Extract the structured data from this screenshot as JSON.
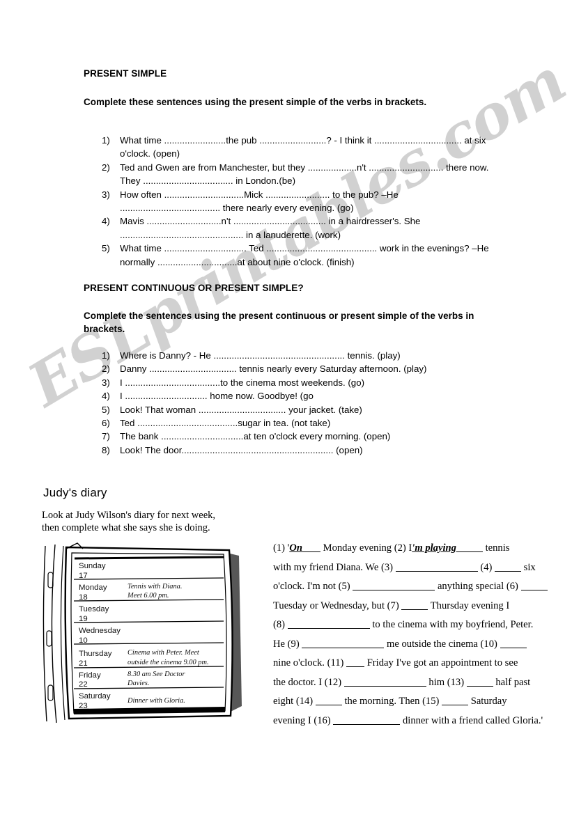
{
  "watermark": {
    "text": "ESLprintables.com"
  },
  "section1": {
    "title": "PRESENT SIMPLE",
    "instruction": "Complete these sentences using the present simple of the verbs in brackets.",
    "items": [
      {
        "num": "1)",
        "text": "What time ........................the pub ..........................?  - I think it .................................. at six o'clock. (open)"
      },
      {
        "num": "2)",
        "text": "Ted and Gwen are from Manchester, but they ...................n't ............................. there now. They ................................... in London.(be)"
      },
      {
        "num": "3)",
        "text": "How often ...............................Mick ......................... to the pub? –He ....................................... there nearly every evening. (go)"
      },
      {
        "num": "4)",
        "text": "Mavis .............................n't .................................... in a hairdresser's. She ................................................ in a lanuderette. (work)"
      },
      {
        "num": "5)",
        "text": "What time ................................ Ted ........................................... work in the evenings? –He normally ...............................at about nine o'clock. (finish)"
      }
    ]
  },
  "section2": {
    "title": "PRESENT CONTINUOUS OR PRESENT SIMPLE?",
    "instruction": "Complete the sentences using the present continuous or present simple of the verbs in brackets.",
    "items": [
      {
        "num": "1)",
        "text": "Where is Danny? - He ................................................... tennis. (play)"
      },
      {
        "num": "2)",
        "text": "Danny .................................. tennis nearly every Saturday afternoon. (play)"
      },
      {
        "num": "3)",
        "text": "I .....................................to the cinema most weekends. (go)"
      },
      {
        "num": "4)",
        "text": "I ................................ home now. Goodbye! (go"
      },
      {
        "num": "5)",
        "text": "Look! That woman .................................. your jacket. (take)"
      },
      {
        "num": "6)",
        "text": "Ted .......................................sugar in tea. (not take)"
      },
      {
        "num": "7)",
        "text": "The bank ................................at ten o'clock every morning. (open)"
      },
      {
        "num": "8)",
        "text": "Look! The door........................................................... (open)"
      }
    ]
  },
  "section3": {
    "title": "Judy's diary",
    "subtitle_line1": "Look at Judy Wilson's diary for next week,",
    "subtitle_line2": "then complete what she says she is doing.",
    "diary": {
      "rows": [
        {
          "day": "Sunday",
          "date": "17",
          "note_line1": "",
          "note_line2": ""
        },
        {
          "day": "Monday",
          "date": "18",
          "note_line1": "Tennis with Diana.",
          "note_line2": "Meet 6.00 pm."
        },
        {
          "day": "Tuesday",
          "date": "19",
          "note_line1": "",
          "note_line2": ""
        },
        {
          "day": "Wednesday",
          "date": "10",
          "note_line1": "",
          "note_line2": ""
        },
        {
          "day": "Thursday",
          "date": "21",
          "note_line1": "Cinema with Peter. Meet",
          "note_line2": "outside the cinema 9.00 pm."
        },
        {
          "day": "Friday",
          "date": "22",
          "note_line1": "8.30 am See Doctor",
          "note_line2": "Davies."
        },
        {
          "day": "Saturday",
          "date": "23",
          "note_line1": "Dinner with Gloria.",
          "note_line2": ""
        }
      ]
    },
    "paragraph": {
      "line1_a": "(1)  '",
      "line1_answer1": "On",
      "line1_b": "Monday evening (2) I",
      "line1_answer2": "'m playing",
      "line1_c": "tennis",
      "line2_a": "with my friend Diana. We (3)",
      "line2_b": "(4)",
      "line2_c": "six",
      "line3_a": "o'clock. I'm not (5)",
      "line3_b": "anything special (6)",
      "line4_a": "Tuesday or Wednesday, but (7)",
      "line4_b": "Thursday evening I",
      "line5_a": "(8)",
      "line5_b": "to the cinema with my boyfriend, Peter.",
      "line6_a": "He (9)",
      "line6_b": "me outside the cinema (10)",
      "line7_a": "nine o'clock. (11)",
      "line7_b": "Friday I've got an appointment to see",
      "line8_a": "the doctor. I (12)",
      "line8_b": "him (13)",
      "line8_c": "half past",
      "line9_a": "eight (14)",
      "line9_b": "the morning. Then (15)",
      "line9_c": "Saturday",
      "line10_a": "evening I (16)",
      "line10_b": "dinner with a friend called Gloria.'"
    }
  }
}
